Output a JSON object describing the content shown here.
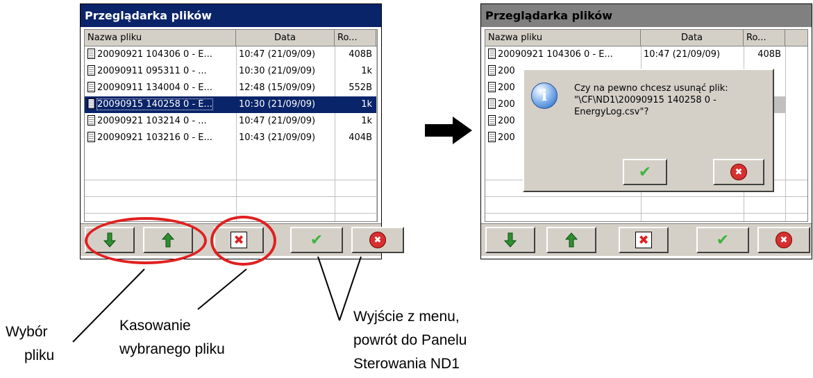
{
  "left_window": {
    "title": "Przeglądarka plików",
    "columns": {
      "name": "Nazwa pliku",
      "date": "Data",
      "size": "Ro..."
    },
    "rows": [
      {
        "name": "20090921 104306 0 - E...",
        "date": "10:47 (21/09/09)",
        "size": "408B",
        "selected": false
      },
      {
        "name": "20090911 095311 0 - ...",
        "date": "10:30 (21/09/09)",
        "size": "1k",
        "selected": false
      },
      {
        "name": "20090911 134004 0 - E...",
        "date": "12:48 (15/09/09)",
        "size": "552B",
        "selected": false
      },
      {
        "name": "20090915 140258 0 - E...",
        "date": "10:30 (21/09/09)",
        "size": "1k",
        "selected": true
      },
      {
        "name": "20090921 103214 0 - ...",
        "date": "10:47 (21/09/09)",
        "size": "1k",
        "selected": false
      },
      {
        "name": "20090921 103216 0 - E...",
        "date": "10:43 (21/09/09)",
        "size": "404B",
        "selected": false
      }
    ]
  },
  "right_window": {
    "title": "Przeglądarka plików",
    "columns": {
      "name": "Nazwa pliku",
      "date": "Data",
      "size": "Ro..."
    },
    "rows": [
      {
        "name": "20090921 104306 0 - E...",
        "date": "10:47 (21/09/09)",
        "size": "408B"
      },
      {
        "name": "200"
      },
      {
        "name": "200"
      },
      {
        "name": "200"
      },
      {
        "name": "200"
      },
      {
        "name": "200"
      }
    ],
    "dialog": {
      "line1": "Czy na pewno chcesz usunąć plik:",
      "line2": "\"\\CF\\ND1\\20090915 140258 0 -",
      "line3": "EnergyLog.csv\"?"
    }
  },
  "toolbar_icons": [
    "arrow-down-icon",
    "arrow-up-icon",
    "delete-file-icon",
    "checkmark-icon",
    "cancel-icon"
  ],
  "annotations": {
    "wybor": [
      "Wybór",
      "pliku"
    ],
    "kasowanie": [
      "Kasowanie",
      "wybranego pliku"
    ],
    "wyjscie": [
      "Wyjście z menu,",
      "powrót do Panelu",
      "Sterowania ND1"
    ]
  },
  "colors": {
    "title_active": "#0a246a",
    "title_inactive": "#808080",
    "highlight": "#e02020",
    "selection": "#0a246a"
  }
}
